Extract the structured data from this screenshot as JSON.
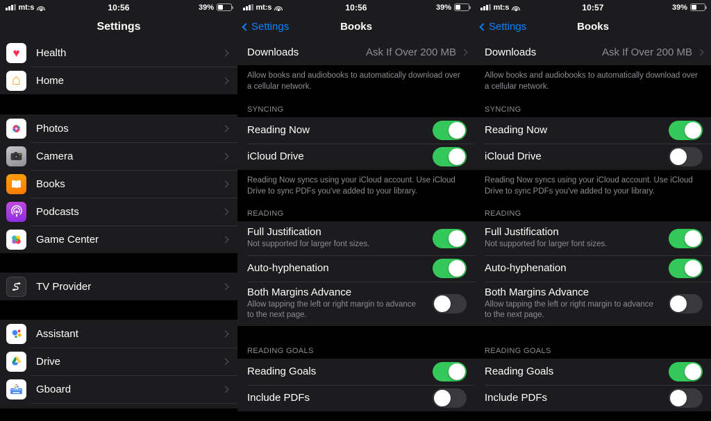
{
  "statusbar": {
    "carrier": "mt:s",
    "time_left": "10:56",
    "time_mid": "10:56",
    "time_right": "10:57",
    "battery_pct": "39%",
    "signal_icon": "cellular-bars-icon",
    "wifi_icon": "wifi-icon",
    "battery_icon": "battery-icon"
  },
  "settings_panel": {
    "title": "Settings",
    "groups": [
      {
        "items": [
          {
            "label": "Health",
            "icon": "health-app-icon"
          },
          {
            "label": "Home",
            "icon": "home-app-icon"
          }
        ]
      },
      {
        "items": [
          {
            "label": "Photos",
            "icon": "photos-app-icon"
          },
          {
            "label": "Camera",
            "icon": "camera-app-icon"
          },
          {
            "label": "Books",
            "icon": "books-app-icon"
          },
          {
            "label": "Podcasts",
            "icon": "podcasts-app-icon"
          },
          {
            "label": "Game Center",
            "icon": "game-center-app-icon"
          }
        ]
      },
      {
        "items": [
          {
            "label": "TV Provider",
            "icon": "tv-provider-icon"
          }
        ]
      },
      {
        "items": [
          {
            "label": "Assistant",
            "icon": "assistant-app-icon"
          },
          {
            "label": "Drive",
            "icon": "drive-app-icon"
          },
          {
            "label": "Gboard",
            "icon": "gboard-app-icon"
          }
        ]
      }
    ]
  },
  "books_panel": {
    "back_label": "Settings",
    "title": "Books",
    "downloads": {
      "label": "Downloads",
      "value": "Ask If Over 200 MB"
    },
    "downloads_footnote": "Allow books and audiobooks to automatically download over a cellular network.",
    "syncing_header": "SYNCING",
    "reading_now": {
      "label": "Reading Now"
    },
    "icloud_drive": {
      "label": "iCloud Drive"
    },
    "syncing_footnote": "Reading Now syncs using your iCloud account. Use iCloud Drive to sync PDFs you've added to your library.",
    "reading_header": "READING",
    "full_justification": {
      "label": "Full Justification",
      "sub": "Not supported for larger font sizes."
    },
    "auto_hyphenation": {
      "label": "Auto-hyphenation"
    },
    "both_margins": {
      "label": "Both Margins Advance",
      "sub": "Allow tapping the left or right margin to advance to the next page."
    },
    "reading_goals_header": "READING GOALS",
    "reading_goals": {
      "label": "Reading Goals"
    },
    "include_pdfs": {
      "label": "Include PDFs"
    }
  },
  "toggle_states": {
    "middle": {
      "reading_now": "on",
      "icloud_drive": "on",
      "full_justification": "on",
      "auto_hyphenation": "on",
      "both_margins": "off",
      "reading_goals": "on",
      "include_pdfs": "off"
    },
    "right": {
      "reading_now": "on",
      "icloud_drive": "off",
      "full_justification": "on",
      "auto_hyphenation": "on",
      "both_margins": "off",
      "reading_goals": "on",
      "include_pdfs": "off"
    }
  },
  "colors": {
    "toggle_on": "#34c759",
    "toggle_off": "#39393d",
    "accent_blue": "#0a84ff",
    "cell_bg": "#1c1c1e",
    "page_bg": "#000000",
    "secondary_text": "#8e8e93"
  }
}
